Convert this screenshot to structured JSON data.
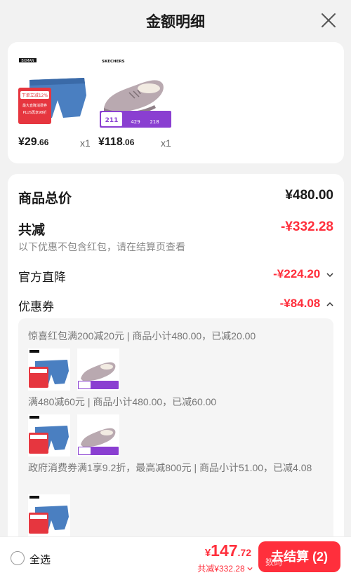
{
  "header": {
    "title": "金额明细"
  },
  "products": [
    {
      "brand": "BXMAN",
      "price_int": "¥29",
      "price_dec": ".66",
      "qty": "x1",
      "badge_lines": [
        "下单立减12%",
        "最大直降消费券",
        "PLUS再享98折"
      ]
    },
    {
      "brand": "SKECHERS",
      "price_int": "¥118",
      "price_dec": ".06",
      "qty": "x1",
      "badge": {
        "a": "211",
        "b": "429",
        "c": "218"
      }
    }
  ],
  "summary": {
    "total_label": "商品总价",
    "total_value": "¥480.00",
    "discount_label": "共减",
    "discount_value": "-¥332.28",
    "note": "以下优惠不包含红包，请在结算页查看",
    "official_label": "官方直降",
    "official_value": "-¥224.20",
    "coupon_label": "优惠券",
    "coupon_value": "-¥84.08"
  },
  "coupons": [
    {
      "text": "惊喜红包满200减20元 | 商品小计480.00，已减20.00"
    },
    {
      "text": "满480减60元 | 商品小计480.00，已减60.00"
    },
    {
      "text": "政府消费券满1享9.2折，最高减800元 | 商品小计51.00，已减4.08"
    }
  ],
  "footer": {
    "select_all": "全选",
    "yen": "¥",
    "total_int": "147",
    "total_dec": ".72",
    "saved": "共减¥332.28",
    "checkout": "去结算 (2)",
    "watermark": "数码"
  },
  "colors": {
    "accent": "#ff2f3c",
    "badge_purple": "#8a3fd1",
    "brief_blue": "#4a7fc1",
    "shoe_gray": "#b9a9b0"
  },
  "icons": [
    "close-icon",
    "check-icon",
    "chevron-down-icon",
    "chevron-up-icon"
  ]
}
